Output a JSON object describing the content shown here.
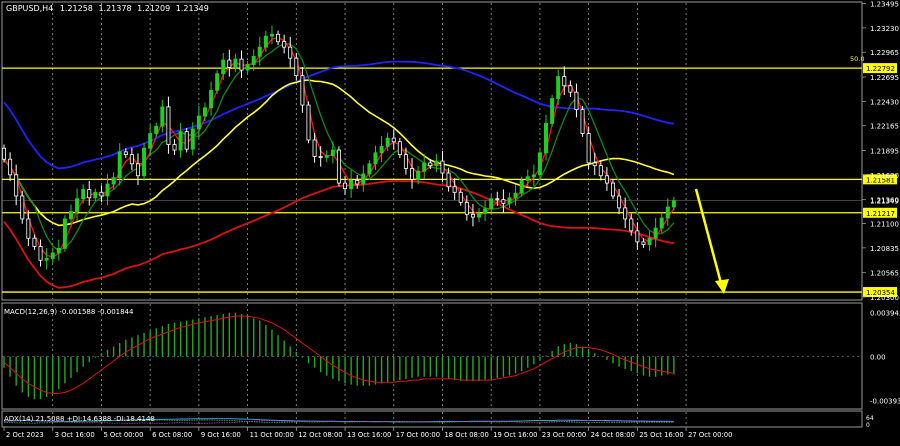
{
  "chart_data": {
    "type": "candlestick",
    "header": {
      "symbol": "GBPUSD,H4",
      "open": "1.21258",
      "high": "1.21378",
      "low": "1.21209",
      "close": "1.21349"
    },
    "price_axis": {
      "ylim": [
        1.203,
        1.2349
      ],
      "ticks": [
        "1.23495",
        "1.23230",
        "1.22965",
        "1.22695",
        "1.22430",
        "1.22165",
        "1.21895",
        "1.21630",
        "1.21360",
        "1.21100",
        "1.20835",
        "1.20565",
        "1.20300"
      ],
      "tick_values": [
        1.23495,
        1.2323,
        1.22965,
        1.22695,
        1.2243,
        1.22165,
        1.21895,
        1.2163,
        1.2136,
        1.211,
        1.20835,
        1.20565,
        1.203
      ]
    },
    "time_axis": {
      "labels": [
        "2 Oct 2023",
        "3 Oct 16:00",
        "5 Oct 00:00",
        "6 Oct 08:00",
        "9 Oct 16:00",
        "11 Oct 00:00",
        "12 Oct 08:00",
        "13 Oct 16:00",
        "17 Oct 00:00",
        "18 Oct 08:00",
        "19 Oct 16:00",
        "23 Oct 00:00",
        "24 Oct 08:00",
        "25 Oct 16:00",
        "27 Oct 00:00"
      ],
      "grid_bar_index": [
        0,
        8,
        16,
        24,
        32,
        40,
        48,
        56,
        64,
        72,
        80,
        88,
        96,
        104,
        112
      ]
    },
    "horizontal_levels": [
      {
        "value": 1.22792,
        "label": "1.22792",
        "color": "#ffff00"
      },
      {
        "value": 1.21581,
        "label": "1.21581",
        "color": "#ffff00"
      },
      {
        "value": 1.21217,
        "label": "1.21217",
        "color": "#ffff00"
      },
      {
        "value": 1.20354,
        "label": "1.20354",
        "color": "#ffff00"
      }
    ],
    "current_price": {
      "value": 1.21349,
      "label": "1.21349"
    },
    "fib_label": "50.0",
    "closes": [
      1.218,
      1.2163,
      1.214,
      1.2115,
      1.2094,
      1.2085,
      1.207,
      1.2072,
      1.2078,
      1.2083,
      1.2115,
      1.2123,
      1.2137,
      1.2147,
      1.2138,
      1.2144,
      1.214,
      1.2153,
      1.216,
      1.2188,
      1.2185,
      1.2175,
      1.2162,
      1.2192,
      1.2208,
      1.2216,
      1.2237,
      1.2196,
      1.219,
      1.221,
      1.2191,
      1.2213,
      1.2227,
      1.2236,
      1.2255,
      1.2273,
      1.2288,
      1.228,
      1.2289,
      1.2277,
      1.2283,
      1.2292,
      1.2302,
      1.2314,
      1.2316,
      1.2308,
      1.2302,
      1.229,
      1.2271,
      1.2239,
      1.2201,
      1.2183,
      1.2182,
      1.2184,
      1.219,
      1.2154,
      1.2148,
      1.2157,
      1.2153,
      1.2164,
      1.2175,
      1.2187,
      1.2194,
      1.2203,
      1.2199,
      1.2185,
      1.217,
      1.2158,
      1.2167,
      1.2176,
      1.2173,
      1.2178,
      1.2165,
      1.215,
      1.2144,
      1.2133,
      1.212,
      1.2117,
      1.2121,
      1.2126,
      1.2137,
      1.2136,
      1.2132,
      1.2138,
      1.2143,
      1.2157,
      1.2161,
      1.2163,
      1.2187,
      1.2219,
      1.2246,
      1.227,
      1.226,
      1.2253,
      1.2234,
      1.2208,
      1.2176,
      1.2173,
      1.2162,
      1.2154,
      1.214,
      1.2127,
      1.2115,
      1.2102,
      1.209,
      1.2087,
      1.2094,
      1.2105,
      1.2116,
      1.2128,
      1.2135
    ],
    "series": [
      {
        "name": "MACD(12,26,9)",
        "values_label": "-0.001588 -0.001844"
      }
    ],
    "indicators": {
      "macd": {
        "label": "MACD(12,26,9) -0.001588 -0.001844",
        "ticks": [
          "0.003943",
          "0.00",
          "-0.003931"
        ],
        "tick_values": [
          0.003943,
          0.0,
          -0.003931
        ],
        "ylim": [
          -0.0045,
          0.0045
        ],
        "histogram": [
          -0.001,
          -0.0018,
          -0.0026,
          -0.0032,
          -0.0036,
          -0.0038,
          -0.0038,
          -0.0036,
          -0.0033,
          -0.0029,
          -0.0024,
          -0.0019,
          -0.0014,
          -0.0009,
          -0.0005,
          -0.0001,
          0.0003,
          0.0006,
          0.0009,
          0.0012,
          0.0015,
          0.0017,
          0.0019,
          0.0021,
          0.0023,
          0.0025,
          0.0027,
          0.0029,
          0.003,
          0.0031,
          0.0032,
          0.0033,
          0.0034,
          0.0035,
          0.0036,
          0.0037,
          0.0038,
          0.0039,
          0.0039,
          0.0038,
          0.0036,
          0.0034,
          0.0032,
          0.0028,
          0.0024,
          0.0019,
          0.0014,
          0.0009,
          0.0004,
          -0.0001,
          -0.0006,
          -0.001,
          -0.0014,
          -0.0017,
          -0.002,
          -0.0022,
          -0.0024,
          -0.0025,
          -0.0026,
          -0.0026,
          -0.0026,
          -0.0025,
          -0.0024,
          -0.0023,
          -0.0022,
          -0.0021,
          -0.002,
          -0.0019,
          -0.0018,
          -0.0018,
          -0.0018,
          -0.0018,
          -0.0019,
          -0.002,
          -0.0021,
          -0.0022,
          -0.0022,
          -0.0022,
          -0.0022,
          -0.0021,
          -0.002,
          -0.0019,
          -0.0018,
          -0.0017,
          -0.0015,
          -0.0013,
          -0.001,
          -0.0007,
          -0.0003,
          0.0001,
          0.0005,
          0.0009,
          0.0011,
          0.0012,
          0.0011,
          0.0009,
          0.0006,
          0.0003,
          0.0,
          -0.0003,
          -0.0006,
          -0.0009,
          -0.0011,
          -0.0013,
          -0.0015,
          -0.0017,
          -0.0018,
          -0.0018,
          -0.0017,
          -0.0016,
          -0.0016
        ],
        "signal": [
          -0.0005,
          -0.001,
          -0.0015,
          -0.002,
          -0.0024,
          -0.0027,
          -0.003,
          -0.0032,
          -0.0033,
          -0.0033,
          -0.0032,
          -0.003,
          -0.0027,
          -0.0024,
          -0.002,
          -0.0016,
          -0.0012,
          -0.0008,
          -0.0004,
          0.0,
          0.0004,
          0.0007,
          0.001,
          0.0013,
          0.0016,
          0.0018,
          0.002,
          0.0022,
          0.0024,
          0.0026,
          0.0027,
          0.0029,
          0.003,
          0.0031,
          0.0032,
          0.0033,
          0.0034,
          0.0035,
          0.0036,
          0.0036,
          0.0036,
          0.0035,
          0.0034,
          0.0032,
          0.003,
          0.0027,
          0.0024,
          0.002,
          0.0016,
          0.0012,
          0.0008,
          0.0004,
          0.0,
          -0.0004,
          -0.0008,
          -0.0011,
          -0.0014,
          -0.0017,
          -0.0019,
          -0.0021,
          -0.0022,
          -0.0023,
          -0.0023,
          -0.0023,
          -0.0023,
          -0.0022,
          -0.0022,
          -0.0021,
          -0.0021,
          -0.002,
          -0.002,
          -0.002,
          -0.002,
          -0.002,
          -0.002,
          -0.0021,
          -0.0021,
          -0.0021,
          -0.0021,
          -0.0021,
          -0.0021,
          -0.002,
          -0.0019,
          -0.0018,
          -0.0017,
          -0.0015,
          -0.0013,
          -0.0011,
          -0.0008,
          -0.0005,
          -0.0002,
          0.0001,
          0.0004,
          0.0006,
          0.0008,
          0.0008,
          0.0008,
          0.0007,
          0.0006,
          0.0004,
          0.0002,
          -0.0001,
          -0.0003,
          -0.0005,
          -0.0007,
          -0.0009,
          -0.0011,
          -0.0012,
          -0.0013,
          -0.0014,
          -0.0015
        ]
      },
      "adx": {
        "label": "ADX(14) 21.5088 +DI:14.6388 -DI:18.4148",
        "ticks": [
          "64",
          "0"
        ],
        "ylim": [
          0,
          70
        ],
        "adx": [
          22,
          24,
          25,
          26,
          26,
          25,
          24,
          23,
          22,
          21,
          20,
          20,
          21,
          22,
          23,
          24,
          25,
          26,
          27,
          28,
          29,
          30,
          31,
          32,
          32,
          33,
          33,
          34,
          34,
          35,
          35,
          36,
          36,
          36,
          37,
          37,
          37,
          37,
          36,
          35,
          34,
          33,
          31,
          30,
          28,
          27,
          26,
          25,
          24,
          24,
          23,
          23,
          22,
          22,
          22,
          21,
          21,
          20,
          20,
          20,
          19,
          19,
          19,
          19,
          18,
          18,
          18,
          18,
          18,
          18,
          18,
          19,
          19,
          20,
          20,
          21,
          21,
          22,
          22,
          22,
          22,
          22,
          22,
          22,
          23,
          23,
          24,
          25,
          26,
          27,
          27,
          28,
          28,
          28,
          28,
          27,
          27,
          26,
          26,
          26,
          25,
          25,
          24,
          24,
          23,
          23,
          22,
          22,
          22,
          22,
          21
        ],
        "plus_di": [
          15,
          14,
          13,
          12,
          11,
          11,
          12,
          13,
          15,
          17,
          19,
          21,
          22,
          23,
          22,
          21,
          22,
          24,
          25,
          26,
          27,
          28,
          27,
          26,
          27,
          28,
          29,
          28,
          27,
          26,
          27,
          28,
          29,
          30,
          29,
          28,
          27,
          26,
          25,
          23,
          21,
          19,
          17,
          16,
          15,
          15,
          16,
          17,
          18,
          19,
          18,
          17,
          18,
          19,
          20,
          19,
          18,
          17,
          18,
          19,
          20,
          21,
          20,
          19,
          18,
          17,
          18,
          19,
          20,
          19,
          18,
          17,
          16,
          17,
          18,
          19,
          20,
          21,
          20,
          19,
          18,
          17,
          18,
          19,
          21,
          23,
          25,
          27,
          26,
          25,
          23,
          21,
          19,
          17,
          16,
          15,
          14,
          14,
          15,
          16,
          15,
          14,
          15,
          16,
          17,
          16,
          15,
          15,
          15,
          15,
          15
        ],
        "minus_di": [
          22,
          24,
          26,
          27,
          27,
          26,
          25,
          23,
          21,
          19,
          17,
          15,
          14,
          13,
          13,
          14,
          13,
          12,
          11,
          11,
          10,
          10,
          11,
          12,
          11,
          10,
          10,
          11,
          12,
          13,
          12,
          11,
          10,
          10,
          11,
          12,
          13,
          14,
          16,
          18,
          20,
          22,
          24,
          25,
          25,
          24,
          23,
          22,
          21,
          20,
          21,
          22,
          21,
          20,
          19,
          20,
          21,
          22,
          21,
          20,
          19,
          18,
          19,
          20,
          21,
          22,
          21,
          20,
          19,
          20,
          21,
          22,
          23,
          22,
          21,
          20,
          19,
          18,
          19,
          20,
          21,
          22,
          21,
          20,
          18,
          16,
          14,
          12,
          13,
          15,
          17,
          19,
          21,
          23,
          24,
          25,
          26,
          26,
          25,
          24,
          23,
          22,
          21,
          20,
          19,
          19,
          18,
          18,
          18,
          18,
          18
        ]
      }
    },
    "grid": true
  }
}
